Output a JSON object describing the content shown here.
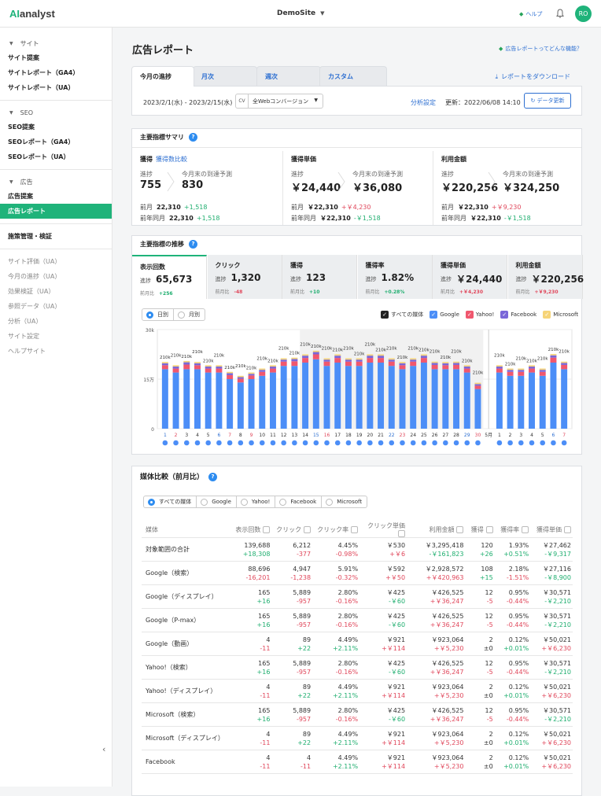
{
  "app": {
    "logo_ai": "AI",
    "logo_rest": "analyst",
    "site": "DemoSite",
    "help": "ヘルプ",
    "user_initials": "RO"
  },
  "sidebar": {
    "sections": [
      {
        "label": "サイト",
        "items": [
          "サイト提案",
          "サイトレポート（GA4）",
          "サイトレポート（UA）"
        ]
      },
      {
        "label": "SEO",
        "items": [
          "SEO提案",
          "SEOレポート（GA4）",
          "SEOレポート（UA）"
        ]
      },
      {
        "label": "広告",
        "items": [
          "広告提案",
          "広告レポート"
        ]
      }
    ],
    "standalone": "施策管理・検証",
    "gray_items": [
      "サイト評価（UA）",
      "今月の進捗（UA）",
      "効果検証（UA）",
      "参照データ（UA）",
      "分析（UA）",
      "サイト設定",
      "ヘルプサイト"
    ]
  },
  "page": {
    "title": "広告レポート",
    "help_link": "広告レポートってどんな機能？",
    "download": "レポートをダウンロード"
  },
  "tabs": [
    "今月の進捗",
    "月次",
    "週次",
    "カスタム"
  ],
  "filter": {
    "date_range": "2023/2/1(水) - 2023/2/15(水)",
    "cv_label": "CV",
    "cv_value": "全Webコンバージョン",
    "analysis": "分析設定",
    "updated": "更新：2022/06/08 14:10",
    "refresh": "データ更新"
  },
  "summary": {
    "title": "主要指標サマリ",
    "cols": [
      {
        "head": "獲得",
        "link": "獲得数比較",
        "progress_label": "進捗",
        "progress": "755",
        "forecast_label": "今月末の到達予測",
        "forecast": "830",
        "prev_label": "前月",
        "prev": "22,310",
        "prev_diff": "+1,518",
        "yoy_label": "前年同月",
        "yoy": "22,310",
        "yoy_diff": "+1,518",
        "prev_color": "green",
        "yoy_color": "green"
      },
      {
        "head": "獲得単価",
        "link": "",
        "progress_label": "進捗",
        "progress": "￥24,440",
        "forecast_label": "今月末の到達予測",
        "forecast": "￥36,080",
        "prev_label": "前月",
        "prev": "￥22,310",
        "prev_diff": "+￥4,230",
        "yoy_label": "前年同月",
        "yoy": "￥22,310",
        "yoy_diff": "-￥1,518",
        "prev_color": "red",
        "yoy_color": "green"
      },
      {
        "head": "利用金額",
        "link": "",
        "progress_label": "進捗",
        "progress": "￥220,256",
        "forecast_label": "今月末の到達予測",
        "forecast": "￥324,250",
        "prev_label": "前月",
        "prev": "￥22,310",
        "prev_diff": "+￥9,230",
        "yoy_label": "前年同月",
        "yoy": "￥22,310",
        "yoy_diff": "-￥1,518",
        "prev_color": "red",
        "yoy_color": "green"
      }
    ]
  },
  "trend": {
    "title": "主要指標の推移",
    "kpis": [
      {
        "name": "表示回数",
        "value": "65,673",
        "mom": "+256",
        "color": "green"
      },
      {
        "name": "クリック",
        "value": "1,320",
        "mom": "-48",
        "color": "red"
      },
      {
        "name": "獲得",
        "value": "123",
        "mom": "+10",
        "color": "green"
      },
      {
        "name": "獲得率",
        "value": "1.82%",
        "mom": "+0.28%",
        "color": "green"
      },
      {
        "name": "獲得単価",
        "value": "￥24,440",
        "mom": "+￥4,230",
        "color": "red"
      },
      {
        "name": "利用金額",
        "value": "￥220,256",
        "mom": "+￥9,230",
        "color": "red"
      }
    ],
    "progress_label": "進捗",
    "mom_label": "前月比",
    "granularity": [
      "日別",
      "月別"
    ],
    "legend": [
      "すべての媒体",
      "Google",
      "Yahoo!",
      "Facebook",
      "Microsoft"
    ]
  },
  "chart_data": {
    "type": "bar",
    "stacked": true,
    "yticks": [
      "30k",
      "15万",
      "0"
    ],
    "categories": [
      "1",
      "2",
      "3",
      "4",
      "5",
      "6",
      "7",
      "8",
      "9",
      "10",
      "11",
      "12",
      "13",
      "14",
      "15",
      "16",
      "17",
      "18",
      "19",
      "20",
      "21",
      "22",
      "23",
      "24",
      "25",
      "26",
      "27",
      "28",
      "29",
      "30",
      "5月",
      "1",
      "2",
      "3",
      "4",
      "5",
      "6",
      "7"
    ],
    "category_colors": [
      "blue",
      "red",
      "default",
      "default",
      "default",
      "blue",
      "red",
      "default",
      "red",
      "default",
      "default",
      "default",
      "default",
      "default",
      "blue",
      "red",
      "default",
      "default",
      "default",
      "default",
      "default",
      "blue",
      "red",
      "default",
      "default",
      "default",
      "default",
      "default",
      "blue",
      "red",
      "default",
      "default",
      "default",
      "default",
      "default",
      "default",
      "blue",
      "red"
    ],
    "series": [
      {
        "name": "Google",
        "color": "#4c8ef7",
        "values": [
          18,
          17,
          18,
          18,
          17,
          17,
          15,
          14,
          15,
          16,
          17,
          19,
          19,
          20,
          21,
          19,
          20,
          19,
          19,
          20,
          20,
          19,
          18,
          19,
          20,
          18,
          18,
          18,
          17,
          12,
          null,
          17,
          16,
          16,
          17,
          16,
          20,
          18
        ]
      },
      {
        "name": "Yahoo!",
        "color": "#f0576e",
        "values": [
          1.2,
          1.2,
          1.4,
          1.2,
          1.2,
          1.2,
          1.2,
          1.1,
          1.1,
          1.2,
          1.2,
          1.3,
          1.4,
          1.4,
          1.5,
          1.3,
          1.4,
          1.3,
          1.3,
          1.4,
          1.4,
          1.3,
          1.2,
          1.3,
          1.4,
          1.3,
          1.2,
          1.3,
          1.2,
          1.0,
          null,
          1.2,
          1.2,
          1.2,
          1.2,
          1.2,
          1.5,
          1.3
        ]
      },
      {
        "name": "Facebook",
        "color": "#7a67d8",
        "values": [
          0.6,
          0.6,
          0.7,
          0.6,
          0.6,
          0.6,
          0.6,
          0.5,
          0.5,
          0.6,
          0.6,
          0.6,
          0.7,
          0.7,
          0.7,
          0.6,
          0.7,
          0.6,
          0.6,
          0.7,
          0.7,
          0.6,
          0.6,
          0.6,
          0.7,
          0.6,
          0.6,
          0.6,
          0.6,
          0.5,
          null,
          0.6,
          0.6,
          0.6,
          0.6,
          0.6,
          0.7,
          0.6
        ]
      },
      {
        "name": "Microsoft",
        "color": "#f6d478",
        "values": [
          0.4,
          0.4,
          0.4,
          0.4,
          0.4,
          0.4,
          0.4,
          0.4,
          0.4,
          0.4,
          0.4,
          0.4,
          0.4,
          0.4,
          0.4,
          0.4,
          0.4,
          0.4,
          0.4,
          0.4,
          0.4,
          0.4,
          0.4,
          0.4,
          0.4,
          0.4,
          0.4,
          0.4,
          0.4,
          0.4,
          null,
          0.4,
          0.4,
          0.4,
          0.4,
          0.4,
          0.4,
          0.4
        ]
      }
    ],
    "data_label": "210k",
    "ylim": [
      0,
      30
    ]
  },
  "media": {
    "title": "媒体比較（前月比）",
    "filters": [
      "すべての媒体",
      "Google",
      "Yahoo!",
      "Facebook",
      "Microsoft"
    ],
    "headers": [
      "媒体",
      "表示回数",
      "クリック",
      "クリック率",
      "クリック単価",
      "利用金額",
      "獲得",
      "獲得率",
      "獲得単価"
    ],
    "rows": [
      {
        "name": "対象範囲の合計",
        "vals": [
          [
            "139,688",
            "+18,308",
            "g"
          ],
          [
            "6,212",
            "-377",
            "r"
          ],
          [
            "4.45%",
            "-0.98%",
            "r"
          ],
          [
            "￥530",
            "+￥6",
            "r"
          ],
          [
            "￥3,295,418",
            "-￥161,823",
            "g"
          ],
          [
            "120",
            "+26",
            "g"
          ],
          [
            "1.93%",
            "+0.51%",
            "g"
          ],
          [
            "￥27,462",
            "-￥9,317",
            "g"
          ]
        ]
      },
      {
        "name": "Google（検索）",
        "vals": [
          [
            "88,696",
            "-16,201",
            "r"
          ],
          [
            "4,947",
            "-1,238",
            "r"
          ],
          [
            "5.91%",
            "-0.32%",
            "r"
          ],
          [
            "￥592",
            "+￥50",
            "r"
          ],
          [
            "￥2,928,572",
            "+￥420,963",
            "r"
          ],
          [
            "108",
            "+15",
            "g"
          ],
          [
            "2.18%",
            "-1.51%",
            "r"
          ],
          [
            "￥27,116",
            "-￥8,900",
            "g"
          ]
        ]
      },
      {
        "name": "Google（ディスプレイ）",
        "vals": [
          [
            "165",
            "+16",
            "g"
          ],
          [
            "5,889",
            "-957",
            "r"
          ],
          [
            "2.80%",
            "-0.16%",
            "r"
          ],
          [
            "￥425",
            "-￥60",
            "g"
          ],
          [
            "￥426,525",
            "+￥36,247",
            "r"
          ],
          [
            "12",
            "-5",
            "r"
          ],
          [
            "0.95%",
            "-0.44%",
            "r"
          ],
          [
            "￥30,571",
            "-￥2,210",
            "g"
          ]
        ]
      },
      {
        "name": "Google（P-max）",
        "vals": [
          [
            "165",
            "+16",
            "g"
          ],
          [
            "5,889",
            "-957",
            "r"
          ],
          [
            "2.80%",
            "-0.16%",
            "r"
          ],
          [
            "￥425",
            "-￥60",
            "g"
          ],
          [
            "￥426,525",
            "+￥36,247",
            "r"
          ],
          [
            "12",
            "-5",
            "r"
          ],
          [
            "0.95%",
            "-0.44%",
            "r"
          ],
          [
            "￥30,571",
            "-￥2,210",
            "g"
          ]
        ]
      },
      {
        "name": "Google（動画）",
        "vals": [
          [
            "4",
            "-11",
            "r"
          ],
          [
            "89",
            "+22",
            "g"
          ],
          [
            "4.49%",
            "+2.11%",
            "g"
          ],
          [
            "￥921",
            "+￥114",
            "r"
          ],
          [
            "￥923,064",
            "+￥5,230",
            "r"
          ],
          [
            "2",
            "±0",
            "n"
          ],
          [
            "0.12%",
            "+0.01%",
            "g"
          ],
          [
            "￥50,021",
            "+￥6,230",
            "r"
          ]
        ]
      },
      {
        "name": "Yahoo!（検索）",
        "vals": [
          [
            "165",
            "+16",
            "g"
          ],
          [
            "5,889",
            "-957",
            "r"
          ],
          [
            "2.80%",
            "-0.16%",
            "r"
          ],
          [
            "￥425",
            "-￥60",
            "g"
          ],
          [
            "￥426,525",
            "+￥36,247",
            "r"
          ],
          [
            "12",
            "-5",
            "r"
          ],
          [
            "0.95%",
            "-0.44%",
            "r"
          ],
          [
            "￥30,571",
            "-￥2,210",
            "g"
          ]
        ]
      },
      {
        "name": "Yahoo!（ディスプレイ）",
        "vals": [
          [
            "4",
            "-11",
            "r"
          ],
          [
            "89",
            "+22",
            "g"
          ],
          [
            "4.49%",
            "+2.11%",
            "g"
          ],
          [
            "￥921",
            "+￥114",
            "r"
          ],
          [
            "￥923,064",
            "+￥5,230",
            "r"
          ],
          [
            "2",
            "±0",
            "n"
          ],
          [
            "0.12%",
            "+0.01%",
            "g"
          ],
          [
            "￥50,021",
            "+￥6,230",
            "r"
          ]
        ]
      },
      {
        "name": "Microsoft（検索）",
        "vals": [
          [
            "165",
            "+16",
            "g"
          ],
          [
            "5,889",
            "-957",
            "r"
          ],
          [
            "2.80%",
            "-0.16%",
            "r"
          ],
          [
            "￥425",
            "-￥60",
            "g"
          ],
          [
            "￥426,525",
            "+￥36,247",
            "r"
          ],
          [
            "12",
            "-5",
            "r"
          ],
          [
            "0.95%",
            "-0.44%",
            "r"
          ],
          [
            "￥30,571",
            "-￥2,210",
            "g"
          ]
        ]
      },
      {
        "name": "Microsoft（ディスプレイ）",
        "vals": [
          [
            "4",
            "-11",
            "r"
          ],
          [
            "89",
            "+22",
            "g"
          ],
          [
            "4.49%",
            "+2.11%",
            "g"
          ],
          [
            "￥921",
            "+￥114",
            "r"
          ],
          [
            "￥923,064",
            "+￥5,230",
            "r"
          ],
          [
            "2",
            "±0",
            "n"
          ],
          [
            "0.12%",
            "+0.01%",
            "g"
          ],
          [
            "￥50,021",
            "+￥6,230",
            "r"
          ]
        ]
      },
      {
        "name": "Facebook",
        "vals": [
          [
            "4",
            "-11",
            "r"
          ],
          [
            "4",
            "-11",
            "r"
          ],
          [
            "4.49%",
            "+2.11%",
            "g"
          ],
          [
            "￥921",
            "+￥114",
            "r"
          ],
          [
            "￥923,064",
            "+￥5,230",
            "r"
          ],
          [
            "2",
            "±0",
            "n"
          ],
          [
            "0.12%",
            "+0.01%",
            "g"
          ],
          [
            "￥50,021",
            "+￥6,230",
            "r"
          ]
        ]
      }
    ]
  }
}
